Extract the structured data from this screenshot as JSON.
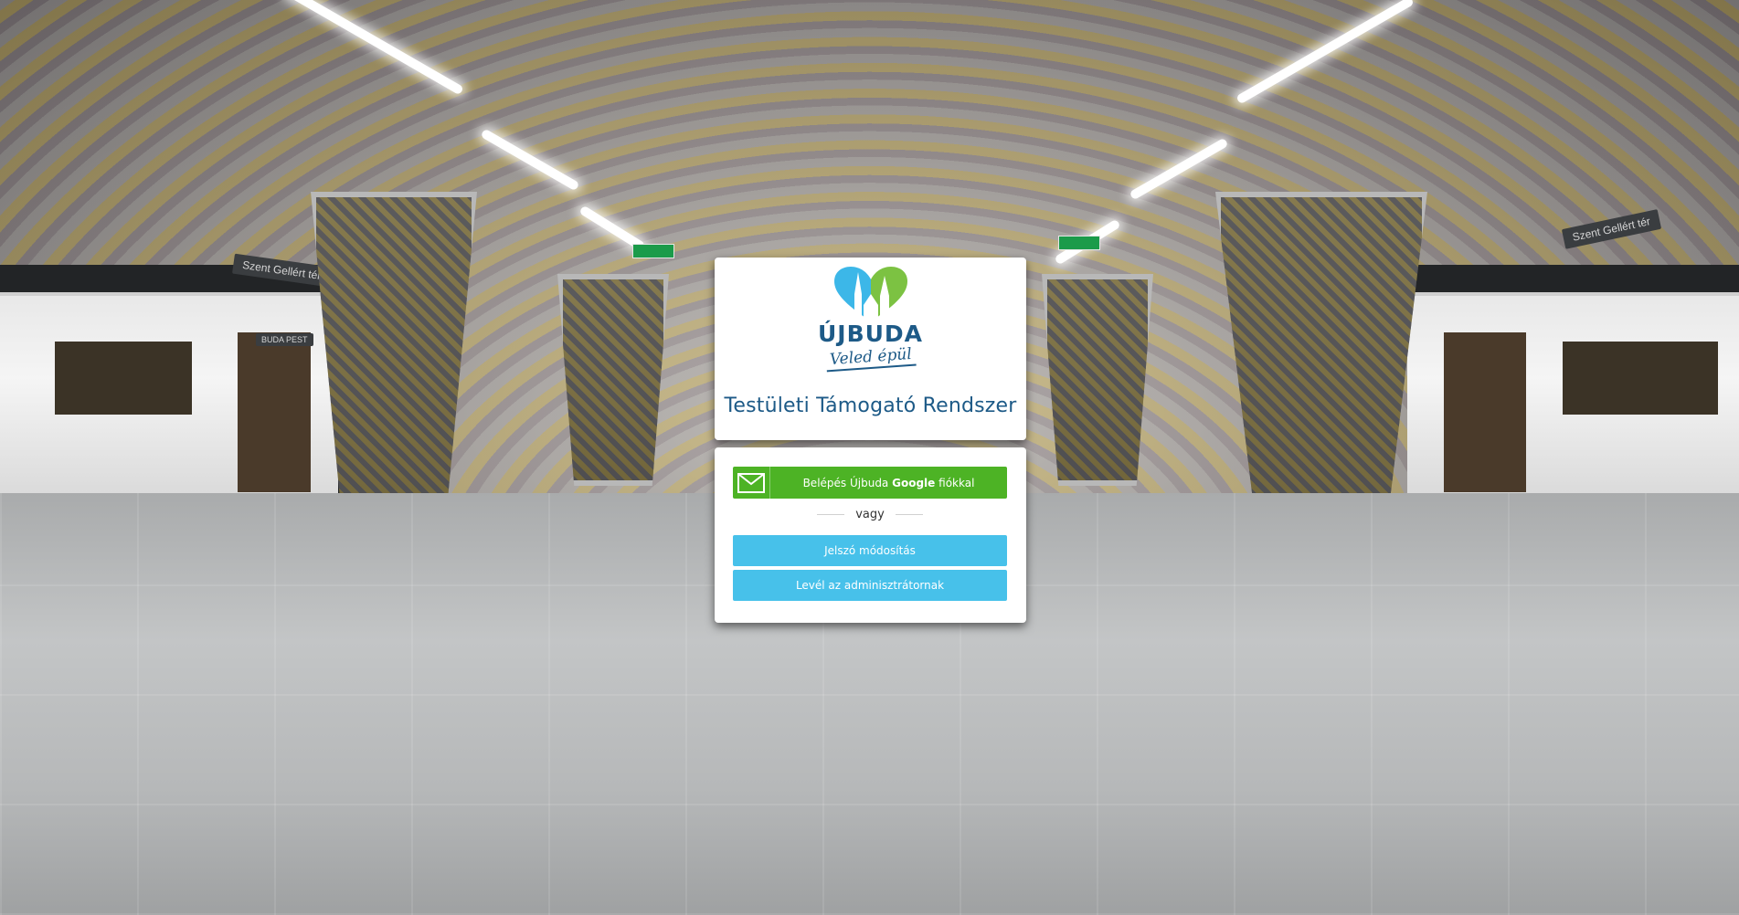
{
  "brand": {
    "name": "ÚJBUDA",
    "tagline": "Veled épül",
    "colors": {
      "primary": "#1d5a87",
      "logo_blue": "#3cb7e8",
      "logo_green": "#7cc242"
    }
  },
  "app_title": {
    "full": "Testületi Támogató Rendszer"
  },
  "login": {
    "google_button": {
      "prefix": "Belépés Újbuda",
      "brand": "Google",
      "suffix": "fiókkal",
      "color": "#4db325",
      "icon": "envelope-icon"
    },
    "separator": "vagy",
    "password_button": {
      "label": "Jelszó módosítás",
      "color": "#47c1ea"
    },
    "admin_button": {
      "label": "Levél az adminisztrátornak",
      "color": "#47c1ea"
    }
  },
  "background": {
    "scene": "metro-station",
    "signs": [
      "Szent Gellért tér",
      "Szent Gellért tér",
      "BUDA PEST"
    ]
  }
}
